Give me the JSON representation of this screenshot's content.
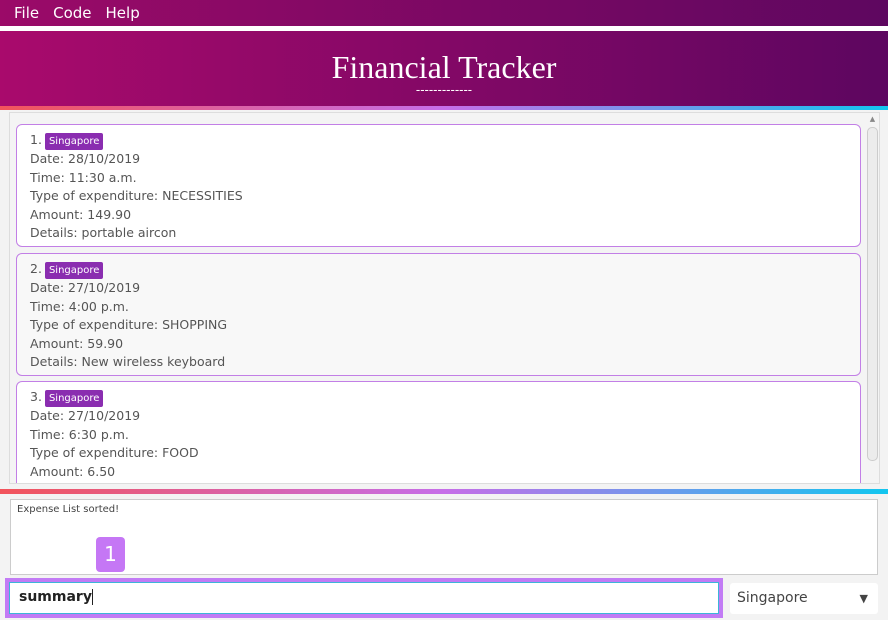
{
  "menu": [
    "File",
    "Code",
    "Help"
  ],
  "header": {
    "title": "Financial Tracker",
    "underline": "-------------"
  },
  "expenses": [
    {
      "index": "1.",
      "country": "Singapore",
      "date": "Date: 28/10/2019",
      "time": "Time: 11:30 a.m.",
      "type": "Type of expenditure: NECESSITIES",
      "amount": "Amount: 149.90",
      "details": "Details: portable aircon"
    },
    {
      "index": "2.",
      "country": "Singapore",
      "date": "Date: 27/10/2019",
      "time": "Time: 4:00 p.m.",
      "type": "Type of expenditure: SHOPPING",
      "amount": "Amount: 59.90",
      "details": "Details: New wireless keyboard"
    },
    {
      "index": "3.",
      "country": "Singapore",
      "date": "Date: 27/10/2019",
      "time": "Time: 6:30 p.m.",
      "type": "Type of expenditure: FOOD",
      "amount": "Amount: 6.50",
      "details": ""
    }
  ],
  "result": "Expense List sorted!",
  "annotation": "1",
  "command": {
    "value": "summary"
  },
  "country_select": {
    "selected": "Singapore",
    "icon": "triangle-down-icon"
  },
  "colors": {
    "accent": "#c27bf5",
    "tag": "#8a2db0",
    "header_start": "#a90a6c",
    "header_end": "#5d0660"
  }
}
